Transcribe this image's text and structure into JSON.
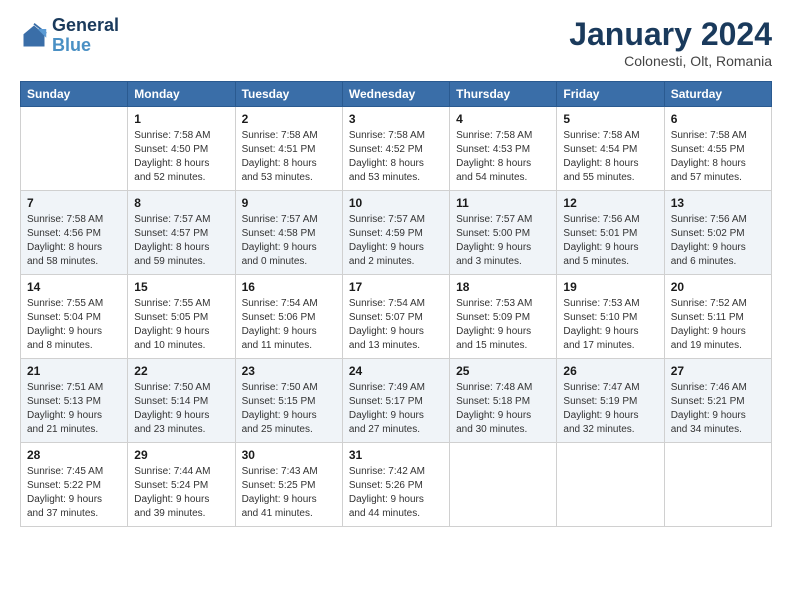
{
  "logo": {
    "line1": "General",
    "line2": "Blue"
  },
  "title": "January 2024",
  "subtitle": "Colonesti, Olt, Romania",
  "weekdays": [
    "Sunday",
    "Monday",
    "Tuesday",
    "Wednesday",
    "Thursday",
    "Friday",
    "Saturday"
  ],
  "weeks": [
    [
      {
        "day": "",
        "info": ""
      },
      {
        "day": "1",
        "info": "Sunrise: 7:58 AM\nSunset: 4:50 PM\nDaylight: 8 hours\nand 52 minutes."
      },
      {
        "day": "2",
        "info": "Sunrise: 7:58 AM\nSunset: 4:51 PM\nDaylight: 8 hours\nand 53 minutes."
      },
      {
        "day": "3",
        "info": "Sunrise: 7:58 AM\nSunset: 4:52 PM\nDaylight: 8 hours\nand 53 minutes."
      },
      {
        "day": "4",
        "info": "Sunrise: 7:58 AM\nSunset: 4:53 PM\nDaylight: 8 hours\nand 54 minutes."
      },
      {
        "day": "5",
        "info": "Sunrise: 7:58 AM\nSunset: 4:54 PM\nDaylight: 8 hours\nand 55 minutes."
      },
      {
        "day": "6",
        "info": "Sunrise: 7:58 AM\nSunset: 4:55 PM\nDaylight: 8 hours\nand 57 minutes."
      }
    ],
    [
      {
        "day": "7",
        "info": "Sunrise: 7:58 AM\nSunset: 4:56 PM\nDaylight: 8 hours\nand 58 minutes."
      },
      {
        "day": "8",
        "info": "Sunrise: 7:57 AM\nSunset: 4:57 PM\nDaylight: 8 hours\nand 59 minutes."
      },
      {
        "day": "9",
        "info": "Sunrise: 7:57 AM\nSunset: 4:58 PM\nDaylight: 9 hours\nand 0 minutes."
      },
      {
        "day": "10",
        "info": "Sunrise: 7:57 AM\nSunset: 4:59 PM\nDaylight: 9 hours\nand 2 minutes."
      },
      {
        "day": "11",
        "info": "Sunrise: 7:57 AM\nSunset: 5:00 PM\nDaylight: 9 hours\nand 3 minutes."
      },
      {
        "day": "12",
        "info": "Sunrise: 7:56 AM\nSunset: 5:01 PM\nDaylight: 9 hours\nand 5 minutes."
      },
      {
        "day": "13",
        "info": "Sunrise: 7:56 AM\nSunset: 5:02 PM\nDaylight: 9 hours\nand 6 minutes."
      }
    ],
    [
      {
        "day": "14",
        "info": "Sunrise: 7:55 AM\nSunset: 5:04 PM\nDaylight: 9 hours\nand 8 minutes."
      },
      {
        "day": "15",
        "info": "Sunrise: 7:55 AM\nSunset: 5:05 PM\nDaylight: 9 hours\nand 10 minutes."
      },
      {
        "day": "16",
        "info": "Sunrise: 7:54 AM\nSunset: 5:06 PM\nDaylight: 9 hours\nand 11 minutes."
      },
      {
        "day": "17",
        "info": "Sunrise: 7:54 AM\nSunset: 5:07 PM\nDaylight: 9 hours\nand 13 minutes."
      },
      {
        "day": "18",
        "info": "Sunrise: 7:53 AM\nSunset: 5:09 PM\nDaylight: 9 hours\nand 15 minutes."
      },
      {
        "day": "19",
        "info": "Sunrise: 7:53 AM\nSunset: 5:10 PM\nDaylight: 9 hours\nand 17 minutes."
      },
      {
        "day": "20",
        "info": "Sunrise: 7:52 AM\nSunset: 5:11 PM\nDaylight: 9 hours\nand 19 minutes."
      }
    ],
    [
      {
        "day": "21",
        "info": "Sunrise: 7:51 AM\nSunset: 5:13 PM\nDaylight: 9 hours\nand 21 minutes."
      },
      {
        "day": "22",
        "info": "Sunrise: 7:50 AM\nSunset: 5:14 PM\nDaylight: 9 hours\nand 23 minutes."
      },
      {
        "day": "23",
        "info": "Sunrise: 7:50 AM\nSunset: 5:15 PM\nDaylight: 9 hours\nand 25 minutes."
      },
      {
        "day": "24",
        "info": "Sunrise: 7:49 AM\nSunset: 5:17 PM\nDaylight: 9 hours\nand 27 minutes."
      },
      {
        "day": "25",
        "info": "Sunrise: 7:48 AM\nSunset: 5:18 PM\nDaylight: 9 hours\nand 30 minutes."
      },
      {
        "day": "26",
        "info": "Sunrise: 7:47 AM\nSunset: 5:19 PM\nDaylight: 9 hours\nand 32 minutes."
      },
      {
        "day": "27",
        "info": "Sunrise: 7:46 AM\nSunset: 5:21 PM\nDaylight: 9 hours\nand 34 minutes."
      }
    ],
    [
      {
        "day": "28",
        "info": "Sunrise: 7:45 AM\nSunset: 5:22 PM\nDaylight: 9 hours\nand 37 minutes."
      },
      {
        "day": "29",
        "info": "Sunrise: 7:44 AM\nSunset: 5:24 PM\nDaylight: 9 hours\nand 39 minutes."
      },
      {
        "day": "30",
        "info": "Sunrise: 7:43 AM\nSunset: 5:25 PM\nDaylight: 9 hours\nand 41 minutes."
      },
      {
        "day": "31",
        "info": "Sunrise: 7:42 AM\nSunset: 5:26 PM\nDaylight: 9 hours\nand 44 minutes."
      },
      {
        "day": "",
        "info": ""
      },
      {
        "day": "",
        "info": ""
      },
      {
        "day": "",
        "info": ""
      }
    ]
  ]
}
